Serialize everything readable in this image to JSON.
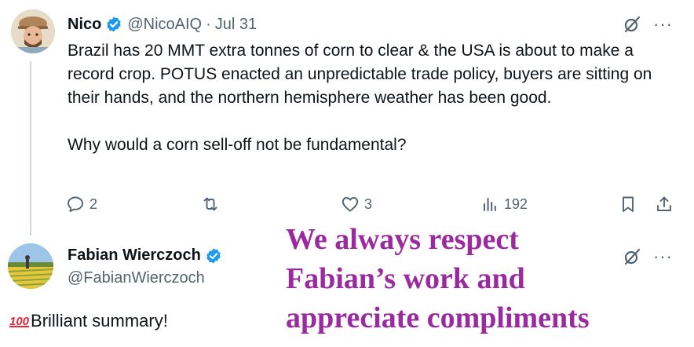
{
  "tweet": {
    "author_name": "Nico",
    "handle": "@NicoAIQ",
    "separator": "·",
    "date": "Jul 31",
    "paragraph1": "Brazil has 20 MMT extra tonnes of corn to clear & the USA is about to make a record crop. POTUS enacted an unpredictable trade policy, buyers are sitting on their hands, and the northern hemisphere weather has been good.",
    "paragraph2": "Why would a corn sell-off not be fundamental?",
    "replies": "2",
    "likes": "3",
    "views": "192",
    "more": "···"
  },
  "reply": {
    "author_name": "Fabian Wierczoch",
    "handle": "@FabianWierczoch",
    "emoji": "100",
    "text": "Brilliant summary!",
    "more": "···"
  },
  "overlay": {
    "line1": "We always respect",
    "line2": "Fabian’s work and",
    "line3": "appreciate compliments"
  },
  "colors": {
    "verified": "#1d9bf0",
    "overlay_text": "#9b2aa0",
    "muted": "#536471",
    "thread_line": "#cfd9de"
  },
  "icons": [
    "verified-badge-icon",
    "grok-icon",
    "more-icon",
    "reply-icon",
    "retweet-icon",
    "like-icon",
    "views-icon",
    "bookmark-icon",
    "share-icon"
  ]
}
